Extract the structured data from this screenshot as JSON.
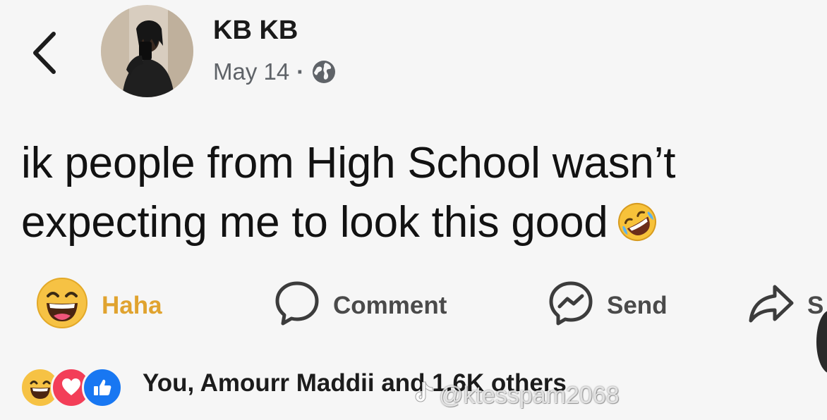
{
  "post": {
    "author": "KB KB",
    "date": "May 14",
    "separator": "·",
    "audience_icon": "globe-icon",
    "text_line1": "ik people from High School wasn’t",
    "text_line2": "expecting me to look this good",
    "text_emoji": "rolling-on-floor-laughing-emoji"
  },
  "actions": {
    "haha_label": "Haha",
    "comment_label": "Comment",
    "send_label": "Send",
    "share_label": "S"
  },
  "reactions": {
    "icons": [
      "haha-reaction-icon",
      "love-reaction-icon",
      "like-reaction-icon"
    ],
    "summary": "You, Amourr Maddii and 1.6K others"
  },
  "watermark": {
    "handle": "@ktesspam2068"
  },
  "colors": {
    "background": "#f6f6f6",
    "haha_yellow": "#e0a32f",
    "like_blue": "#1877f2",
    "love_red": "#f33e58"
  }
}
